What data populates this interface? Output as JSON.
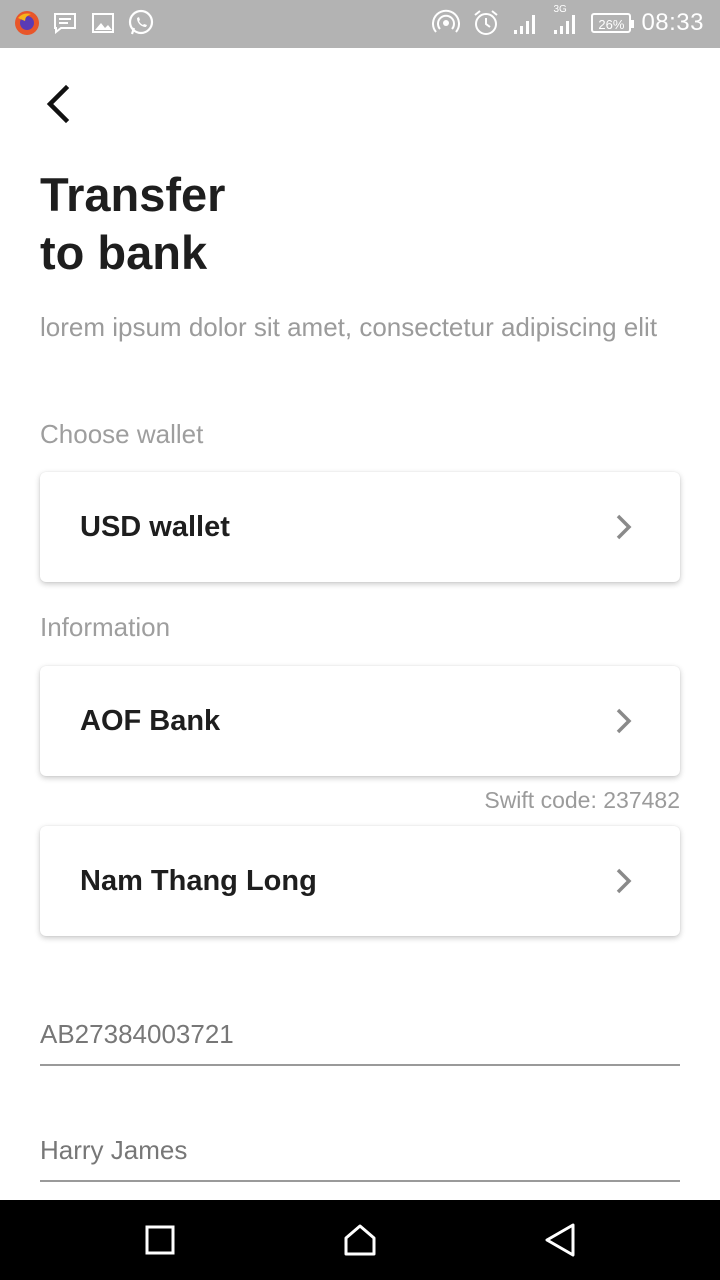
{
  "status_bar": {
    "left_icons": [
      "firefox-icon",
      "message-icon",
      "gallery-icon",
      "whatsapp-icon"
    ],
    "right_icons": [
      "hotspot-icon",
      "alarm-icon",
      "signal-icon",
      "signal-3g-icon"
    ],
    "network_label": "3G",
    "battery": "26%",
    "time": "08:33"
  },
  "header": {
    "back_icon": "chevron-left-icon",
    "title_line1": "Transfer",
    "title_line2": "to bank",
    "subtitle": "lorem ipsum dolor sit amet, consectetur adipiscing elit"
  },
  "wallet_section": {
    "label": "Choose wallet",
    "selected_wallet": "USD wallet"
  },
  "information_section": {
    "label": "Information",
    "bank": "AOF Bank",
    "swift_code": "Swift code: 237482",
    "branch": "Nam Thang Long",
    "account_number": "AB27384003721",
    "account_holder": "Harry James"
  },
  "nav_bar": {
    "buttons": [
      "recents-icon",
      "home-icon",
      "back-triangle-icon"
    ]
  },
  "colors": {
    "title": "#1e1e1e",
    "muted": "#9b9b9b",
    "status_bar": "#b3b3b3",
    "nav_bar": "#000000"
  }
}
